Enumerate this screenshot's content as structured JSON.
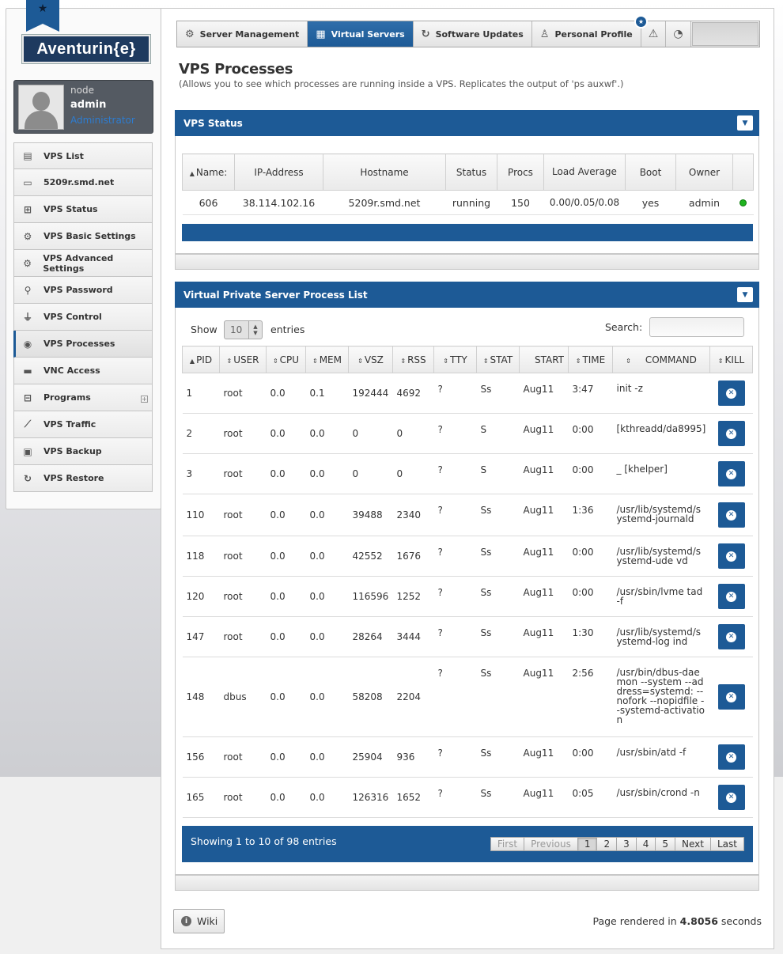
{
  "brand": {
    "logo_text": "Aventurin{e}"
  },
  "user": {
    "role_line": "node",
    "name": "admin",
    "level": "Administrator"
  },
  "sidebar": {
    "items": [
      {
        "label": "VPS List",
        "icon": "list-icon"
      },
      {
        "label": "5209r.smd.net",
        "icon": "laptop-icon"
      },
      {
        "label": "VPS Status",
        "icon": "medkit-icon"
      },
      {
        "label": "VPS Basic Settings",
        "icon": "gear-icon"
      },
      {
        "label": "VPS Advanced Settings",
        "icon": "gears-icon"
      },
      {
        "label": "VPS Password",
        "icon": "key-icon"
      },
      {
        "label": "VPS Control",
        "icon": "plug-icon"
      },
      {
        "label": "VPS Processes",
        "icon": "gauge-icon"
      },
      {
        "label": "VNC Access",
        "icon": "monitor-icon"
      },
      {
        "label": "Programs",
        "icon": "sitemap-icon"
      },
      {
        "label": "VPS Traffic",
        "icon": "chart-icon"
      },
      {
        "label": "VPS Backup",
        "icon": "archive-icon"
      },
      {
        "label": "VPS Restore",
        "icon": "refresh-icon"
      }
    ]
  },
  "tabs": [
    {
      "label": "Server Management",
      "icon": "gear-icon"
    },
    {
      "label": "Virtual Servers",
      "icon": "grid-icon"
    },
    {
      "label": "Software Updates",
      "icon": "refresh-icon"
    },
    {
      "label": "Personal Profile",
      "icon": "user-icon"
    }
  ],
  "notification_badge": "★",
  "page": {
    "title": "VPS Processes",
    "subtitle": "(Allows you to see which processes are running inside a VPS. Replicates the output of 'ps auxwf'.)"
  },
  "status_panel": {
    "title": "VPS Status",
    "headers": {
      "name": "Name:",
      "ip": "IP-Address",
      "hostname": "Hostname",
      "status": "Status",
      "procs": "Procs",
      "load": "Load Average",
      "boot": "Boot",
      "owner": "Owner"
    },
    "row": {
      "name": "606",
      "ip": "38.114.102.16",
      "hostname": "5209r.smd.net",
      "status": "running",
      "procs": "150",
      "load": "0.00/0.05/0.08",
      "boot": "yes",
      "owner": "admin"
    }
  },
  "process_panel": {
    "title": "Virtual Private Server Process List",
    "show_label": "Show",
    "entries_label": "entries",
    "page_size": "10",
    "search_label": "Search:",
    "search_value": "",
    "headers": {
      "pid": "PID",
      "user": "USER",
      "cpu": "CPU",
      "mem": "MEM",
      "vsz": "VSZ",
      "rss": "RSS",
      "tty": "TTY",
      "stat": "STAT",
      "start": "START",
      "time": "TIME",
      "command": "COMMAND",
      "kill": "KILL"
    },
    "rows": [
      {
        "pid": "1",
        "user": "root",
        "cpu": "0.0",
        "mem": "0.1",
        "vsz": "192444",
        "rss": "4692",
        "tty": "?",
        "stat": "Ss",
        "start": "Aug11",
        "time": "3:47",
        "command": "init -z"
      },
      {
        "pid": "2",
        "user": "root",
        "cpu": "0.0",
        "mem": "0.0",
        "vsz": "0",
        "rss": "0",
        "tty": "?",
        "stat": "S",
        "start": "Aug11",
        "time": "0:00",
        "command": "[kthreadd/da8995]"
      },
      {
        "pid": "3",
        "user": "root",
        "cpu": "0.0",
        "mem": "0.0",
        "vsz": "0",
        "rss": "0",
        "tty": "?",
        "stat": "S",
        "start": "Aug11",
        "time": "0:00",
        "command": "_ [khelper]"
      },
      {
        "pid": "110",
        "user": "root",
        "cpu": "0.0",
        "mem": "0.0",
        "vsz": "39488",
        "rss": "2340",
        "tty": "?",
        "stat": "Ss",
        "start": "Aug11",
        "time": "1:36",
        "command": "/usr/lib/systemd/systemd-journald"
      },
      {
        "pid": "118",
        "user": "root",
        "cpu": "0.0",
        "mem": "0.0",
        "vsz": "42552",
        "rss": "1676",
        "tty": "?",
        "stat": "Ss",
        "start": "Aug11",
        "time": "0:00",
        "command": "/usr/lib/systemd/systemd-ude vd"
      },
      {
        "pid": "120",
        "user": "root",
        "cpu": "0.0",
        "mem": "0.0",
        "vsz": "116596",
        "rss": "1252",
        "tty": "?",
        "stat": "Ss",
        "start": "Aug11",
        "time": "0:00",
        "command": "/usr/sbin/lvme tad -f"
      },
      {
        "pid": "147",
        "user": "root",
        "cpu": "0.0",
        "mem": "0.0",
        "vsz": "28264",
        "rss": "3444",
        "tty": "?",
        "stat": "Ss",
        "start": "Aug11",
        "time": "1:30",
        "command": "/usr/lib/systemd/systemd-log ind"
      },
      {
        "pid": "148",
        "user": "dbus",
        "cpu": "0.0",
        "mem": "0.0",
        "vsz": "58208",
        "rss": "2204",
        "tty": "?",
        "stat": "Ss",
        "start": "Aug11",
        "time": "2:56",
        "command": "/usr/bin/dbus-daemon --system --address=systemd: --nofork --nopidfile --systemd-activation"
      },
      {
        "pid": "156",
        "user": "root",
        "cpu": "0.0",
        "mem": "0.0",
        "vsz": "25904",
        "rss": "936",
        "tty": "?",
        "stat": "Ss",
        "start": "Aug11",
        "time": "0:00",
        "command": "/usr/sbin/atd -f"
      },
      {
        "pid": "165",
        "user": "root",
        "cpu": "0.0",
        "mem": "0.0",
        "vsz": "126316",
        "rss": "1652",
        "tty": "?",
        "stat": "Ss",
        "start": "Aug11",
        "time": "0:05",
        "command": "/usr/sbin/crond -n"
      }
    ],
    "showing_text": "Showing 1 to 10 of 98 entries",
    "pagination": {
      "first": "First",
      "previous": "Previous",
      "pages": [
        "1",
        "2",
        "3",
        "4",
        "5"
      ],
      "next": "Next",
      "last": "Last"
    }
  },
  "footer": {
    "wiki_label": "Wiki",
    "rendered_prefix": "Page rendered in",
    "rendered_value": "4.8056",
    "rendered_suffix": "seconds"
  },
  "colors": {
    "accent": "#1d5a96",
    "status_ok": "#1fb31f"
  }
}
